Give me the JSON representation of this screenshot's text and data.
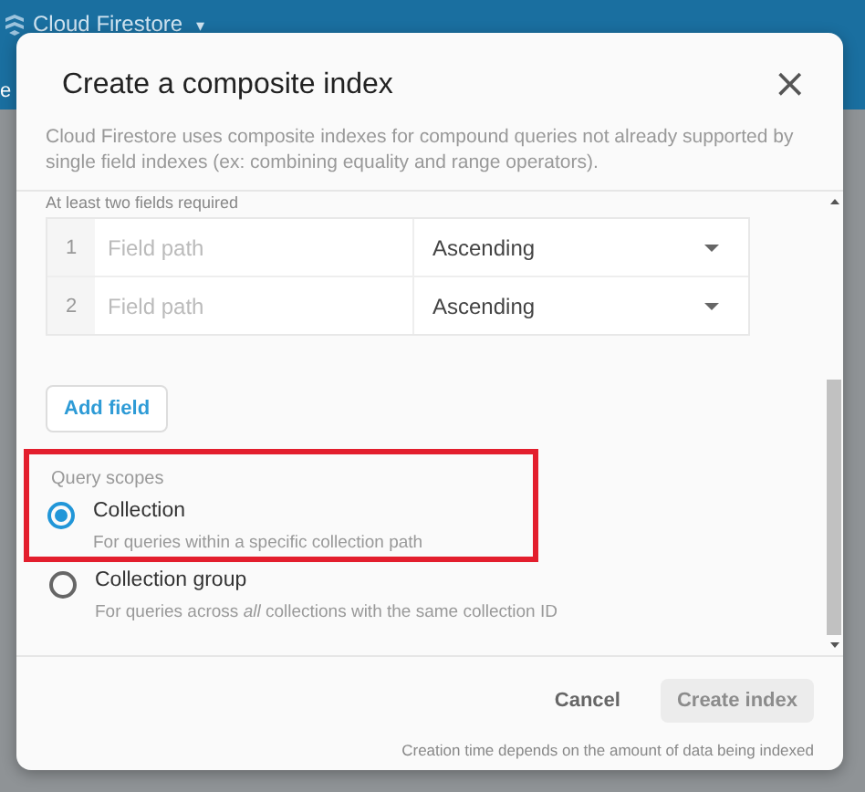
{
  "app_bar": {
    "product": "Cloud Firestore",
    "caret": "▾"
  },
  "background_tab": {
    "label": "e"
  },
  "dialog": {
    "title": "Create a composite index",
    "close": "×",
    "description": "Cloud Firestore uses composite indexes for compound queries not already supported by single field indexes (ex: combining equality and range operators).",
    "fields_hint": "At least two fields required",
    "fields": [
      {
        "number": "1",
        "placeholder": "Field path",
        "order": "Ascending"
      },
      {
        "number": "2",
        "placeholder": "Field path",
        "order": "Ascending"
      }
    ],
    "add_field": "Add field",
    "query_scopes": {
      "label": "Query scopes",
      "highlighted": true,
      "options": [
        {
          "label": "Collection",
          "description": "For queries within a specific collection path",
          "selected": true
        },
        {
          "label": "Collection group",
          "description": "For queries across *all* collections with the same collection ID",
          "selected": false
        }
      ]
    },
    "cancel": "Cancel",
    "create": {
      "label": "Create index",
      "disabled": true
    },
    "note": "Creation time depends on the amount of data being indexed"
  }
}
